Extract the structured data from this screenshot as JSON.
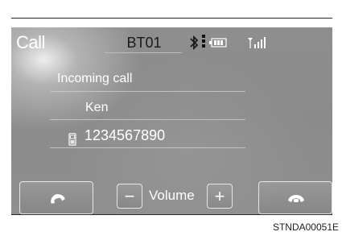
{
  "screen": {
    "title": "Call",
    "device_name": "BT01",
    "status_icons": [
      "bluetooth-icon",
      "battery-icon",
      "signal-strength-icon"
    ]
  },
  "call": {
    "status": "Incoming call",
    "caller_name": "Ken",
    "caller_number": "1234567890",
    "number_icon": "mobile-phone-icon"
  },
  "controls": {
    "accept_icon": "handset-icon",
    "decline_icon": "handset-icon",
    "volume_minus": "−",
    "volume_label": "Volume",
    "volume_plus": "+"
  },
  "caption": "STNDA00051E",
  "colors": {
    "screen_bg": "#8e8e8e",
    "text": "#ffffff"
  }
}
